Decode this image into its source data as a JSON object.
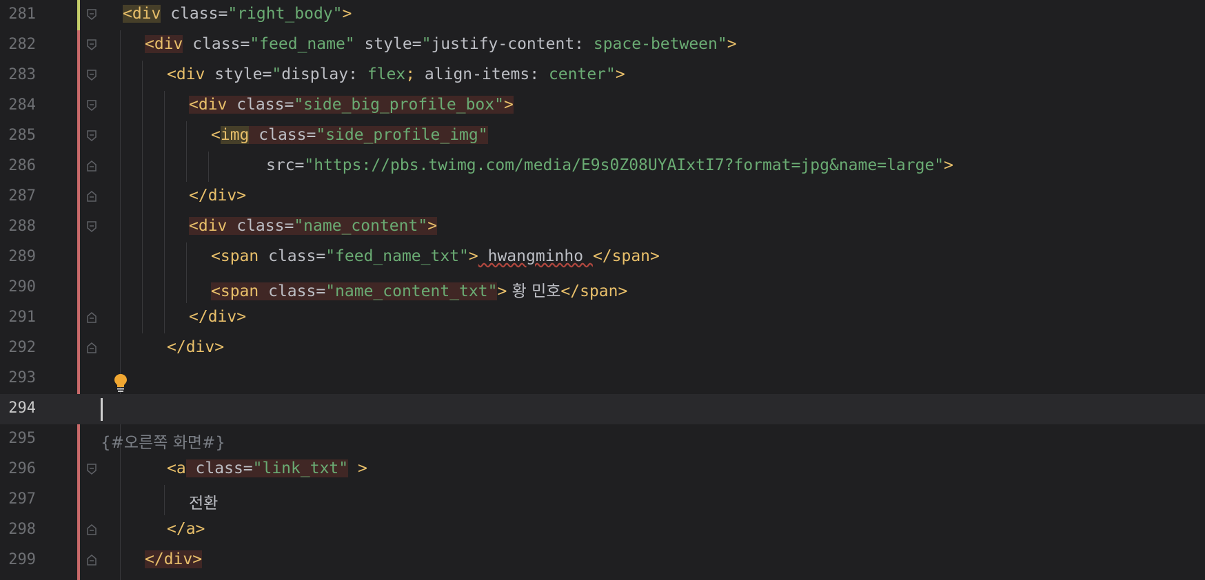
{
  "editor": {
    "current_line": "294",
    "lines": [
      {
        "num": "281",
        "text": "<div class=\"right_body\">"
      },
      {
        "num": "282",
        "text": "<div class=\"feed_name\" style=\"justify-content: space-between\">"
      },
      {
        "num": "283",
        "text": "<div style=\"display: flex; align-items: center\">"
      },
      {
        "num": "284",
        "text": "<div class=\"side_big_profile_box\">"
      },
      {
        "num": "285",
        "text": "<img class=\"side_profile_img\""
      },
      {
        "num": "286",
        "text": "src=\"https://pbs.twimg.com/media/E9s0Z08UYAIxtI7?format=jpg&name=large\">"
      },
      {
        "num": "287",
        "text": "</div>"
      },
      {
        "num": "288",
        "text": "<div class=\"name_content\">"
      },
      {
        "num": "289",
        "text": "<span class=\"feed_name_txt\"> hwangminho </span>"
      },
      {
        "num": "290",
        "text": "<span class=\"name_content_txt\"> 황 민호</span>"
      },
      {
        "num": "291",
        "text": "</div>"
      },
      {
        "num": "292",
        "text": "</div>"
      },
      {
        "num": "293",
        "text": ""
      },
      {
        "num": "294",
        "text": ""
      },
      {
        "num": "295",
        "text": "{#오른쪽 화면#}"
      },
      {
        "num": "296",
        "text": "<a class=\"link_txt\" >"
      },
      {
        "num": "297",
        "text": "전환"
      },
      {
        "num": "298",
        "text": "</a>"
      },
      {
        "num": "299",
        "text": "</div>"
      }
    ]
  },
  "tokens": {
    "l281": {
      "open": "<div",
      "attr": " class=",
      "val": "\"right_body\"",
      "close": ">"
    },
    "l282": {
      "open": "<div",
      "attr1": " class=",
      "val1": "\"feed_name\"",
      "attr2": " style=",
      "q1": "\"",
      "prop": "justify-content: ",
      "pval": "space-between",
      "q2": "\"",
      "close": ">"
    },
    "l283": {
      "open": "<div",
      "attr": " style=",
      "q1": "\"",
      "prop1": "display: ",
      "pval1": "flex",
      "semi": ";",
      "prop2": " align-items: ",
      "pval2": "center",
      "q2": "\"",
      "close": ">"
    },
    "l284": {
      "open": "<div",
      "attr": " class=",
      "val": "\"side_big_profile_box\"",
      "close": ">"
    },
    "l285": {
      "lt": "<",
      "tag": "img",
      "attr": " class=",
      "val": "\"side_profile_img\""
    },
    "l286": {
      "attr": "src=",
      "val": "\"https://pbs.twimg.com/media/E9s0Z08UYAIxtI7?format=jpg&name=large\"",
      "close": ">"
    },
    "l287": {
      "tag": "</div>"
    },
    "l288": {
      "open": "<div",
      "attr": " class=",
      "val": "\"name_content\"",
      "close": ">"
    },
    "l289": {
      "open": "<span",
      "attr": " class=",
      "val": "\"feed_name_txt\"",
      "close": ">",
      "text": " hwangminho ",
      "end": "</span>"
    },
    "l290": {
      "open": "<span",
      "attr": " class=",
      "val": "\"name_content_txt\"",
      "close": ">",
      "text": " 황 민호",
      "end": "</span>"
    },
    "l291": {
      "tag": "</div>"
    },
    "l292": {
      "tag": "</div>"
    },
    "l295": {
      "comment": "{#오른쪽 화면#}"
    },
    "l296": {
      "open": "<a",
      "attr": " class=",
      "val": "\"link_txt\"",
      "close": " >"
    },
    "l297": {
      "text": "전환"
    },
    "l298": {
      "tag": "</a>"
    },
    "l299": {
      "tag": "</div>"
    }
  },
  "colors": {
    "background": "#1f1f21",
    "tag": "#e8bf6a",
    "string": "#6aab73",
    "attribute": "#bcbec4",
    "line_number": "#6d6f73",
    "change_marker_modified": "#c5cd6a",
    "change_marker_added": "#c96a6a"
  },
  "icons": {
    "fold_marker": "fold-icon",
    "intention_bulb": "lightbulb-icon"
  }
}
